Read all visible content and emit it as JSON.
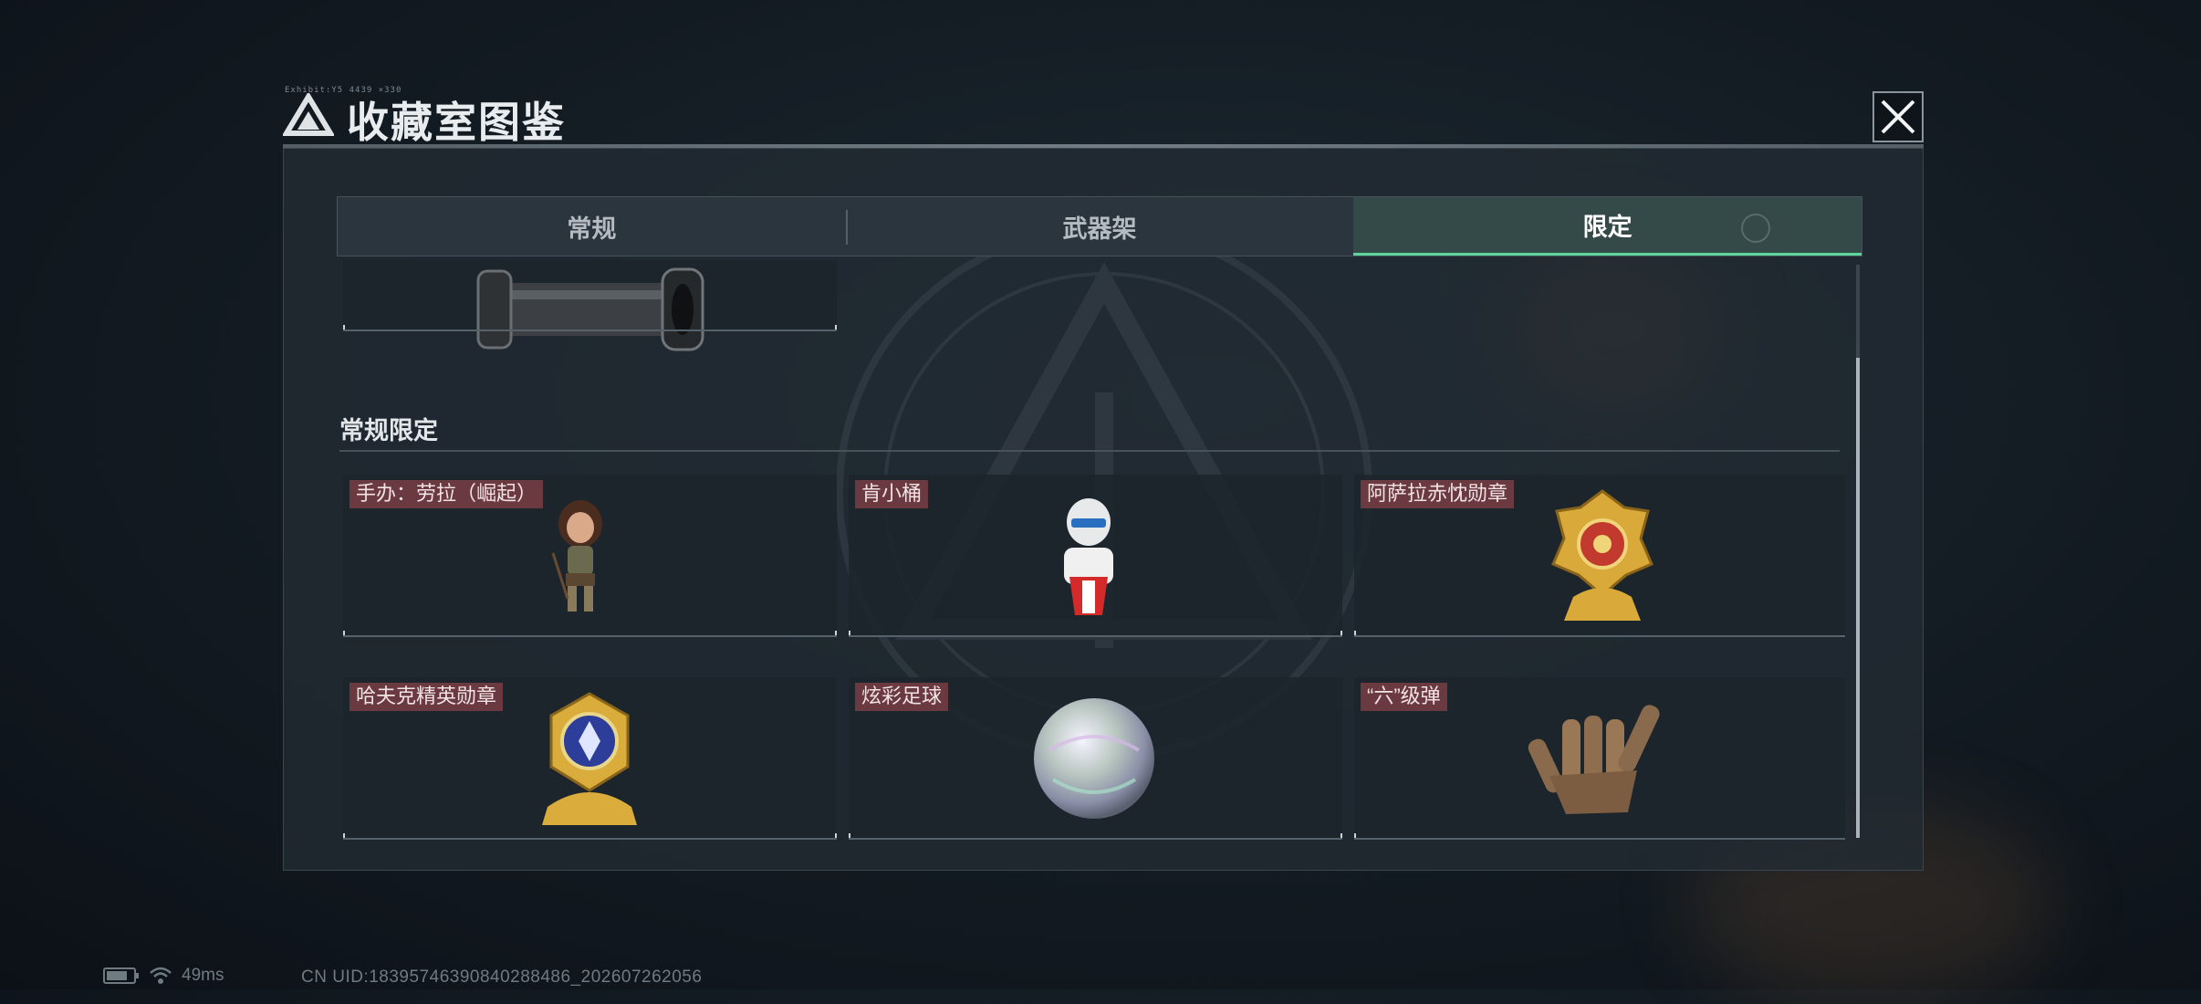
{
  "window": {
    "title": "收藏室图鉴",
    "small_code": "Exhibit:Y5 4439 ×330",
    "close_icon": "close-icon"
  },
  "tabs": [
    {
      "label": "常规",
      "active": false
    },
    {
      "label": "武器架",
      "active": false
    },
    {
      "label": "限定",
      "active": true
    }
  ],
  "top_item": {
    "art": "cylinder-part-icon"
  },
  "section": {
    "title": "常规限定",
    "items": [
      {
        "label": "手办：劳拉（崛起）",
        "art": "lara-figure-icon"
      },
      {
        "label": "肯小桶",
        "art": "colonel-bucket-icon"
      },
      {
        "label": "阿萨拉赤忱勋章",
        "art": "gold-medal-icon"
      },
      {
        "label": "哈夫克精英勋章",
        "art": "elite-badge-icon"
      },
      {
        "label": "炫彩足球",
        "art": "iridescent-ball-icon"
      },
      {
        "label": "“六”级弹",
        "art": "bullet-hand-icon"
      }
    ]
  },
  "status": {
    "ping": "49ms",
    "uid": "CN UID:18395746390840288486_202607262056"
  },
  "colors": {
    "accent": "#5ed49f",
    "label_bg": "#6b3a40",
    "panel_bg": "#222b33"
  }
}
